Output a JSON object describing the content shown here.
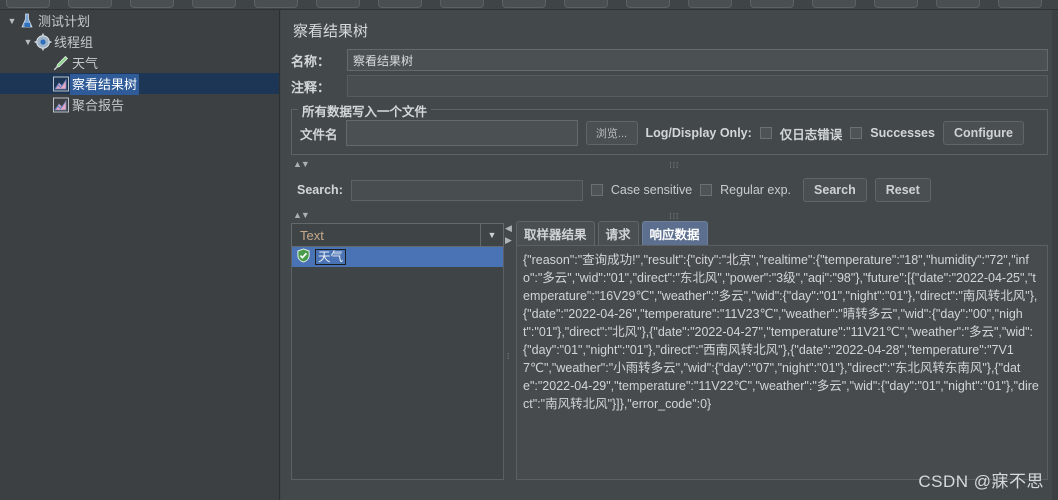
{
  "window": {
    "watermark": "CSDN @寐不思"
  },
  "toolbar": {
    "button_count": 17
  },
  "tree": {
    "items": [
      {
        "label": "测试计划",
        "icon": "test-plan-icon",
        "indent": 1,
        "twisty": "▼",
        "selected": false
      },
      {
        "label": "线程组",
        "icon": "thread-group-gear-icon",
        "indent": 2,
        "twisty": "▼",
        "selected": false
      },
      {
        "label": "天气",
        "icon": "http-sampler-icon",
        "indent": 3,
        "twisty": "",
        "selected": false
      },
      {
        "label": "察看结果树",
        "icon": "listener-chart-icon",
        "indent": 3,
        "twisty": "",
        "selected": true
      },
      {
        "label": "聚合报告",
        "icon": "listener-chart-icon",
        "indent": 3,
        "twisty": "",
        "selected": false
      }
    ]
  },
  "panel": {
    "title": "察看结果树",
    "name_label": "名称：",
    "name_value": "察看结果树",
    "comment_label": "注释：",
    "comment_value": ""
  },
  "file_group": {
    "title": "所有数据写入一个文件",
    "filename_label": "文件名",
    "filename_value": "",
    "browse_button": "浏览...",
    "log_display_label": "Log/Display Only:",
    "errors_only_checkbox": "仅日志错误",
    "errors_only_checked": false,
    "successes_checkbox": "Successes",
    "successes_checked": false,
    "configure_button": "Configure"
  },
  "search": {
    "label": "Search:",
    "value": "",
    "case_sensitive_label": "Case sensitive",
    "case_sensitive_checked": false,
    "regex_label": "Regular exp.",
    "regex_checked": false,
    "search_button": "Search",
    "reset_button": "Reset"
  },
  "results": {
    "renderer_selected": "Text",
    "items": [
      {
        "label": "天气",
        "status": "success",
        "selected": true
      }
    ]
  },
  "tabs": [
    {
      "label": "取样器结果",
      "active": false
    },
    {
      "label": "请求",
      "active": false
    },
    {
      "label": "响应数据",
      "active": true
    }
  ],
  "response": {
    "body": "{\"reason\":\"查询成功!\",\"result\":{\"city\":\"北京\",\"realtime\":{\"temperature\":\"18\",\"humidity\":\"72\",\"info\":\"多云\",\"wid\":\"01\",\"direct\":\"东北风\",\"power\":\"3级\",\"aqi\":\"98\"},\"future\":[{\"date\":\"2022-04-25\",\"temperature\":\"16V29℃\",\"weather\":\"多云\",\"wid\":{\"day\":\"01\",\"night\":\"01\"},\"direct\":\"南风转北风\"},{\"date\":\"2022-04-26\",\"temperature\":\"11V23℃\",\"weather\":\"晴转多云\",\"wid\":{\"day\":\"00\",\"night\":\"01\"},\"direct\":\"北风\"},{\"date\":\"2022-04-27\",\"temperature\":\"11V21℃\",\"weather\":\"多云\",\"wid\":{\"day\":\"01\",\"night\":\"01\"},\"direct\":\"西南风转北风\"},{\"date\":\"2022-04-28\",\"temperature\":\"7V17℃\",\"weather\":\"小雨转多云\",\"wid\":{\"day\":\"07\",\"night\":\"01\"},\"direct\":\"东北风转东南风\"},{\"date\":\"2022-04-29\",\"temperature\":\"11V22℃\",\"weather\":\"多云\",\"wid\":{\"day\":\"01\",\"night\":\"01\"},\"direct\":\"南风转北风\"}]},\"error_code\":0}"
  },
  "colors": {
    "window_bg": "#3f4447",
    "panel_bg": "#43484b",
    "tree_bg": "#3c4043",
    "selection_blue": "#2f5b99",
    "list_selection": "#4a73b5",
    "active_tab": "#5c6f8e",
    "response_bg": "#474b4d",
    "success_green": "#4a9b4a"
  }
}
